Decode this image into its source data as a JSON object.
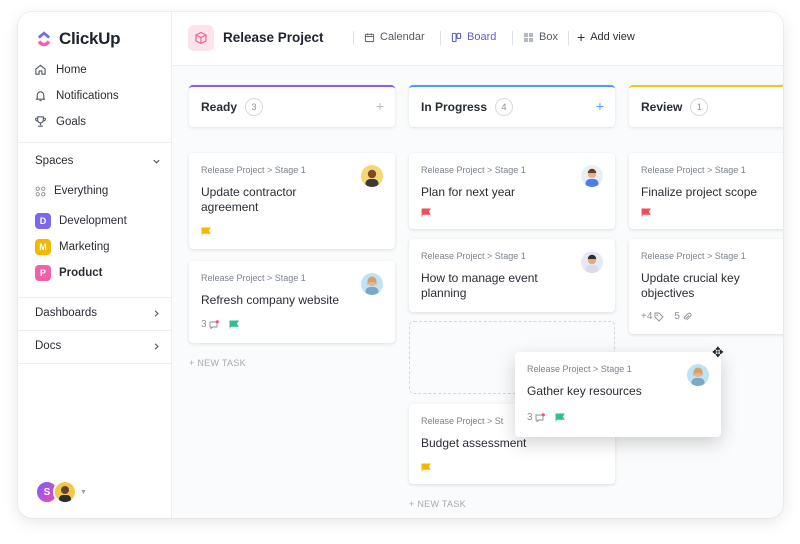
{
  "app": {
    "name": "ClickUp"
  },
  "sidebar": {
    "nav": [
      {
        "label": "Home",
        "icon": "home-icon"
      },
      {
        "label": "Notifications",
        "icon": "bell-icon"
      },
      {
        "label": "Goals",
        "icon": "trophy-icon"
      }
    ],
    "spaces_title": "Spaces",
    "everything": "Everything",
    "spaces": [
      {
        "letter": "D",
        "label": "Development",
        "color": "#7b68ee"
      },
      {
        "letter": "M",
        "label": "Marketing",
        "color": "#f5b800"
      },
      {
        "letter": "P",
        "label": "Product",
        "color": "#f061a8"
      }
    ],
    "dashboards": "Dashboards",
    "docs": "Docs",
    "user_initial": "S"
  },
  "header": {
    "project_title": "Release Project",
    "views": {
      "calendar": "Calendar",
      "board": "Board",
      "box": "Box",
      "add": "Add view"
    }
  },
  "board": {
    "columns": [
      {
        "title": "Ready",
        "count": "3",
        "color": "#8b5cf6"
      },
      {
        "title": "In Progress",
        "count": "4",
        "color": "#4c9aff"
      },
      {
        "title": "Review",
        "count": "1",
        "color": "#f5c518"
      }
    ],
    "path": "Release Project > Stage 1",
    "path_truncated": "Release Project > St",
    "new_task": "+ NEW TASK",
    "cards": {
      "c1": {
        "title": "Update contractor agreement"
      },
      "c2": {
        "title": "Refresh company website",
        "comments": "3"
      },
      "c3": {
        "title": "Plan for next year"
      },
      "c4": {
        "title": "How to manage event planning"
      },
      "c5": {
        "title": "Budget assessment"
      },
      "c6": {
        "title": "Finalize project scope"
      },
      "c7": {
        "title": "Update crucial key objectives",
        "tags": "+4",
        "attachments": "5"
      },
      "c8": {
        "title": "Gather key resources",
        "comments": "3"
      }
    }
  }
}
